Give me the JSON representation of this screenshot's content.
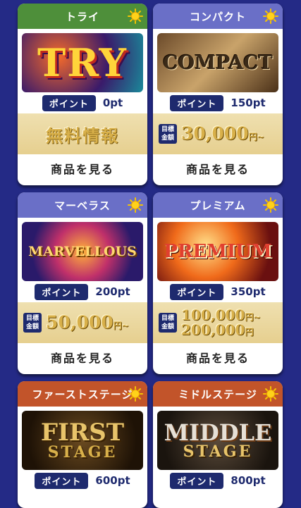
{
  "cards": [
    {
      "title": "トライ",
      "header_color": "#4e8f3a",
      "banner_text": "TRY",
      "point_label": "ポイント",
      "point_value": "0pt",
      "info_text": "無料情報",
      "view_label": "商品を見る"
    },
    {
      "title": "コンパクト",
      "header_color": "#6a6fc7",
      "banner_text": "COMPACT",
      "point_label": "ポイント",
      "point_value": "150pt",
      "target_label_1": "目標",
      "target_label_2": "金額",
      "amount_1": "30,000",
      "unit": "円~",
      "view_label": "商品を見る"
    },
    {
      "title": "マーベラス",
      "header_color": "#6a6fc7",
      "banner_text": "MARVELLOUS",
      "point_label": "ポイント",
      "point_value": "200pt",
      "target_label_1": "目標",
      "target_label_2": "金額",
      "amount_1": "50,000",
      "unit": "円~",
      "view_label": "商品を見る"
    },
    {
      "title": "プレミアム",
      "header_color": "#6a6fc7",
      "banner_text": "PREMIUM",
      "point_label": "ポイント",
      "point_value": "350pt",
      "target_label_1": "目標",
      "target_label_2": "金額",
      "amount_1": "100,000",
      "amount_2": "200,000",
      "unit": "円~",
      "unit_2": "円",
      "view_label": "商品を見る"
    },
    {
      "title": "ファーストステージ",
      "header_color": "#c2542a",
      "banner_text_1": "FIRST",
      "banner_text_2": "STAGE",
      "point_label": "ポイント",
      "point_value": "600pt"
    },
    {
      "title": "ミドルステージ",
      "header_color": "#c2542a",
      "banner_text_1": "MIDDLE",
      "banner_text_2": "STAGE",
      "point_label": "ポイント",
      "point_value": "800pt"
    }
  ],
  "icons": {
    "header_icon": "sun-icon"
  },
  "colors": {
    "background": "#242a86",
    "badge": "#1e2a6e",
    "gold": "#d8b04a"
  }
}
